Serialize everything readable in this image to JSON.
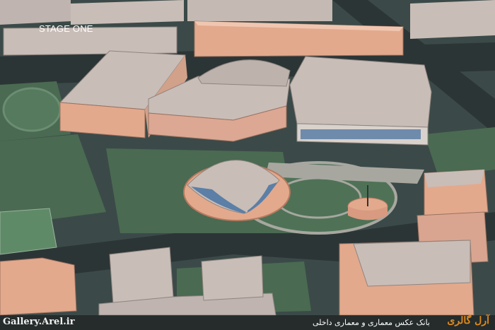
{
  "stage_label": "STAGE ONE",
  "watermark": {
    "site": "Gallery.Arel.ir",
    "brand": "آرل گالری",
    "description": "بانک عکس معماری و معماری داخلی"
  },
  "colors": {
    "ground": "#3b4a48",
    "grass": "#4a6a52",
    "road": "#2c3536",
    "roof": "#c9bdb7",
    "facade": "#e3a98d",
    "glass": "#5b7fa6",
    "path": "#a7a7a0",
    "accent_brand": "#e08a1e"
  }
}
